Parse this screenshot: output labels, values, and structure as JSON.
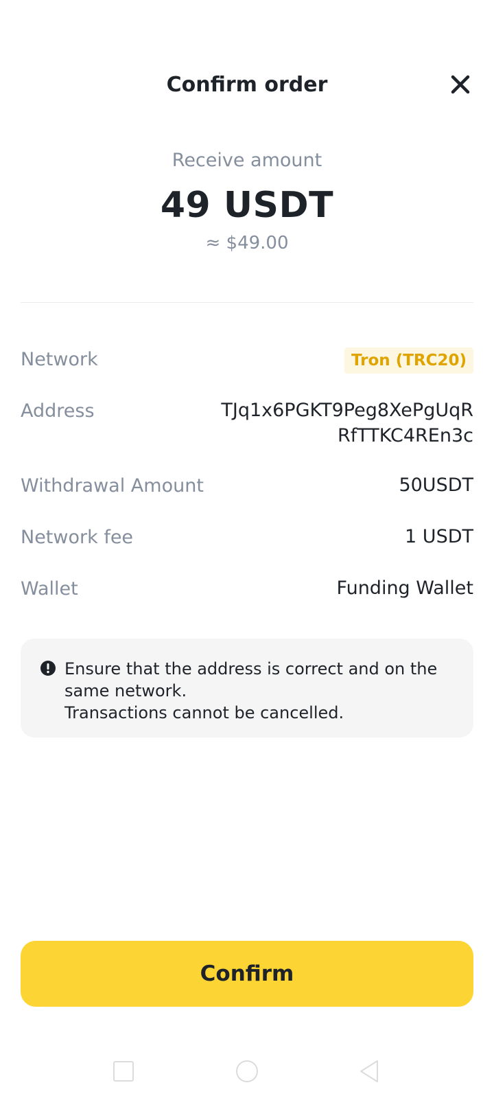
{
  "header": {
    "title": "Confirm order"
  },
  "summary": {
    "receive_label": "Receive amount",
    "receive_amount": "49 USDT",
    "receive_fiat": "≈ $49.00"
  },
  "details": {
    "network_label": "Network",
    "network_value": "Tron (TRC20)",
    "address_label": "Address",
    "address_value": "TJq1x6PGKT9Peg8XePgUqRRfTTKC4REn3c",
    "amount_label": "Withdrawal Amount",
    "amount_value": "50USDT",
    "fee_label": "Network fee",
    "fee_value": "1 USDT",
    "wallet_label": "Wallet",
    "wallet_value": "Funding Wallet"
  },
  "notice": {
    "line1": "Ensure that the address is correct and on the same network.",
    "line2": "Transactions cannot be cancelled."
  },
  "actions": {
    "confirm_label": "Confirm"
  },
  "colors": {
    "accent": "#fcd535",
    "network_tag_text": "#e0a400",
    "network_tag_bg": "#fdf6e0",
    "muted_text": "#848e9c"
  },
  "icons": {
    "close": "close-icon",
    "warning": "warning-icon",
    "nav_recents": "recents-square-icon",
    "nav_home": "home-circle-icon",
    "nav_back": "back-triangle-icon"
  }
}
